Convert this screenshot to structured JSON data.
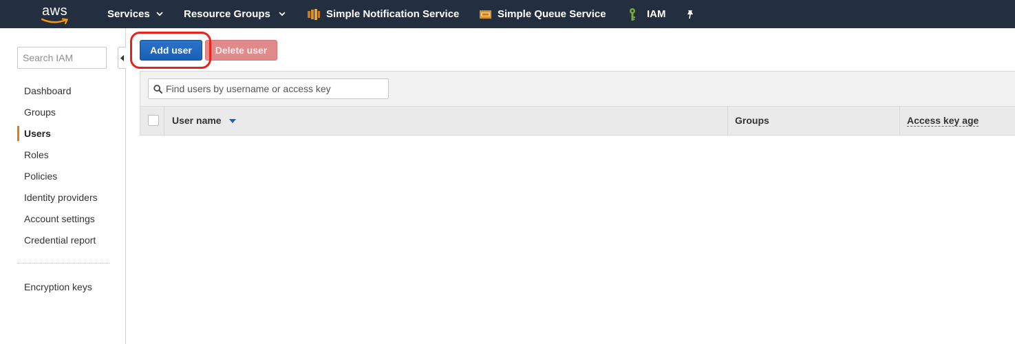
{
  "topnav": {
    "logo_text": "aws",
    "services_label": "Services",
    "resource_groups_label": "Resource Groups",
    "pinned": [
      {
        "label": "Simple Notification Service",
        "icon": "sns-icon"
      },
      {
        "label": "Simple Queue Service",
        "icon": "sqs-icon"
      },
      {
        "label": "IAM",
        "icon": "iam-key-icon"
      }
    ],
    "pin_icon": "pin-icon"
  },
  "sidebar": {
    "search_placeholder": "Search IAM",
    "items": [
      {
        "label": "Dashboard"
      },
      {
        "label": "Groups"
      },
      {
        "label": "Users",
        "active": true
      },
      {
        "label": "Roles"
      },
      {
        "label": "Policies"
      },
      {
        "label": "Identity providers"
      },
      {
        "label": "Account settings"
      },
      {
        "label": "Credential report"
      }
    ],
    "extra_items": [
      {
        "label": "Encryption keys"
      }
    ]
  },
  "toolbar": {
    "add_user_label": "Add user",
    "delete_user_label": "Delete user"
  },
  "users_table": {
    "filter_placeholder": "Find users by username or access key",
    "columns": [
      {
        "label": "User name",
        "sorted": "desc"
      },
      {
        "label": "Groups"
      },
      {
        "label": "Access key age"
      }
    ],
    "rows": []
  },
  "colors": {
    "nav_bg": "#232f3e",
    "primary_button": "#1860b8",
    "danger_button_disabled": "#e08b8b",
    "active_accent": "#e47911",
    "highlight_ring": "#e8221a"
  }
}
